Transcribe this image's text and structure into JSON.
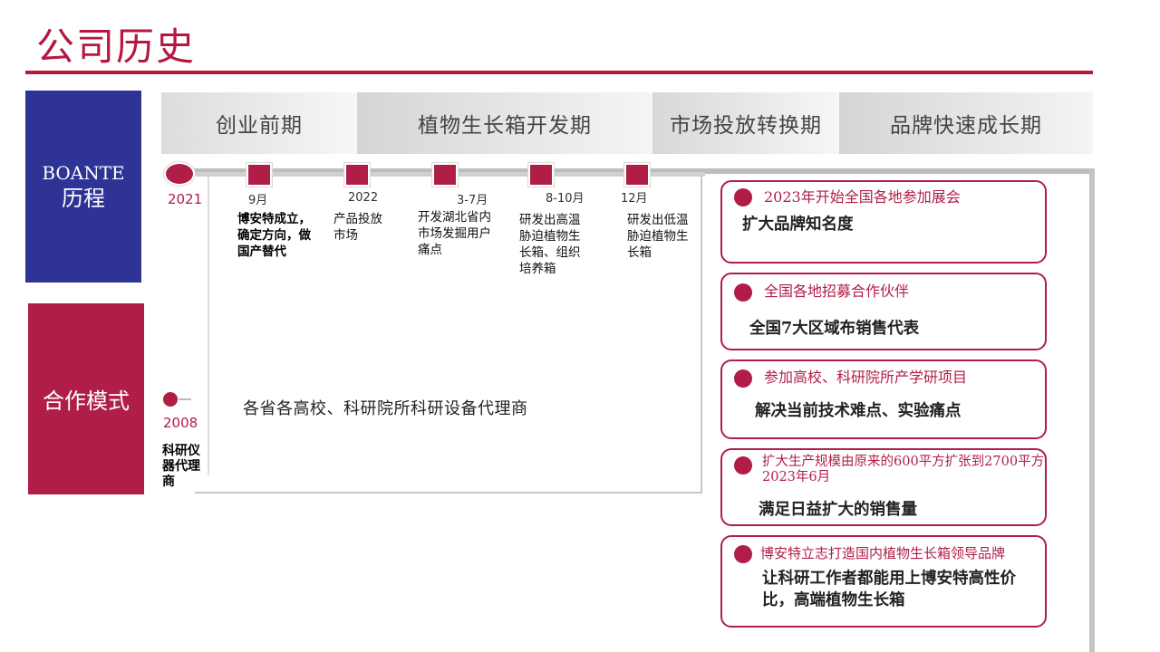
{
  "title": "公司历史",
  "left_blocks": {
    "boante_line1": "BOANTE",
    "boante_line2": "历程",
    "cooperation": "合作模式"
  },
  "phases": [
    "创业前期",
    "植物生长箱开发期",
    "市场投放转换期",
    "品牌快速成长期"
  ],
  "timeline": {
    "start_year": "2021",
    "events": [
      {
        "date": "9月",
        "text": "博安特成立，确定方向，做国产替代"
      },
      {
        "date": "2022",
        "text": "产品投放市场"
      },
      {
        "date": "3-7月",
        "text": "开发湖北省内市场发掘用户痛点"
      },
      {
        "date": "8-10月",
        "text": "研发出高温胁迫植物生长箱、组织培养箱"
      },
      {
        "date": "12月",
        "text": "研发出低温胁迫植物生长箱"
      }
    ]
  },
  "cooperation": {
    "year": "2008",
    "left_text": "科研仪器代理商",
    "description": "各省各高校、科研院所科研设备代理商"
  },
  "cards": [
    {
      "head": "2023年开始全国各地参加展会",
      "body": "扩大品牌知名度"
    },
    {
      "head": "全国各地招募合作伙伴",
      "body": "全国7大区域布销售代表"
    },
    {
      "head": "参加高校、科研院所产学研项目",
      "body": "解决当前技术难点、实验痛点"
    },
    {
      "head": "扩大生产规模由原来的600平方扩张到2700平方    2023年6月",
      "body": "满足日益扩大的销售量"
    },
    {
      "head": "博安特立志打造国内植物生长箱领导品牌",
      "body": "让科研工作者都能用上博安特高性价比，高端植物生长箱"
    }
  ],
  "colors": {
    "accent": "#b01e47",
    "navy": "#2f3396"
  }
}
